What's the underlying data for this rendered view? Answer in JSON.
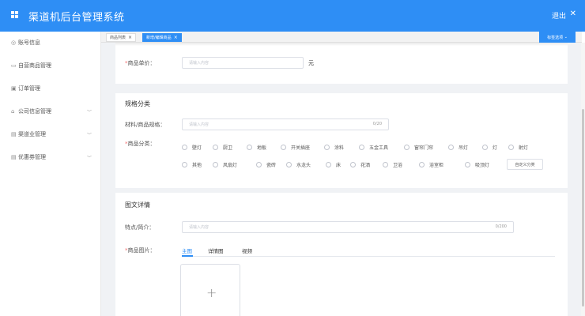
{
  "header": {
    "title": "渠道机后台管理系统",
    "logout": "退出"
  },
  "sidebar": {
    "items": [
      {
        "label": "账号信息"
      },
      {
        "label": "自营商品管理"
      },
      {
        "label": "订单管理"
      },
      {
        "label": "公司信息管理"
      },
      {
        "label": "渠道业管理"
      },
      {
        "label": "优惠券管理"
      }
    ]
  },
  "tabs": [
    {
      "label": "商品列表"
    },
    {
      "label": "新增/编辑商品"
    }
  ],
  "tab_select": "标签选项",
  "price": {
    "label": "商品单价：",
    "placeholder": "请输入内容",
    "unit": "元"
  },
  "spec": {
    "section_title": "规格分类",
    "material_label": "材料/商品规格：",
    "material_placeholder": "请输入内容",
    "material_count": "0/20",
    "category_label": "商品分类：",
    "categories": [
      "壁灯",
      "厨卫",
      "地板",
      "开关插座",
      "涂料",
      "五金工具",
      "窗帘门帘",
      "吊灯",
      "灯",
      "射灯",
      "其他",
      "风扇灯",
      "瓷砖",
      "水龙头",
      "床",
      "花洒",
      "卫浴",
      "浴室柜",
      "吸顶灯"
    ],
    "custom_button": "自定义分类"
  },
  "detail": {
    "section_title": "图文详情",
    "feature_label": "特点/简介：",
    "feature_placeholder": "请输入内容",
    "feature_count": "0/200",
    "image_label": "商品图片：",
    "image_tabs": [
      "主图",
      "详情图",
      "视频"
    ],
    "upload_symbol": "+"
  }
}
